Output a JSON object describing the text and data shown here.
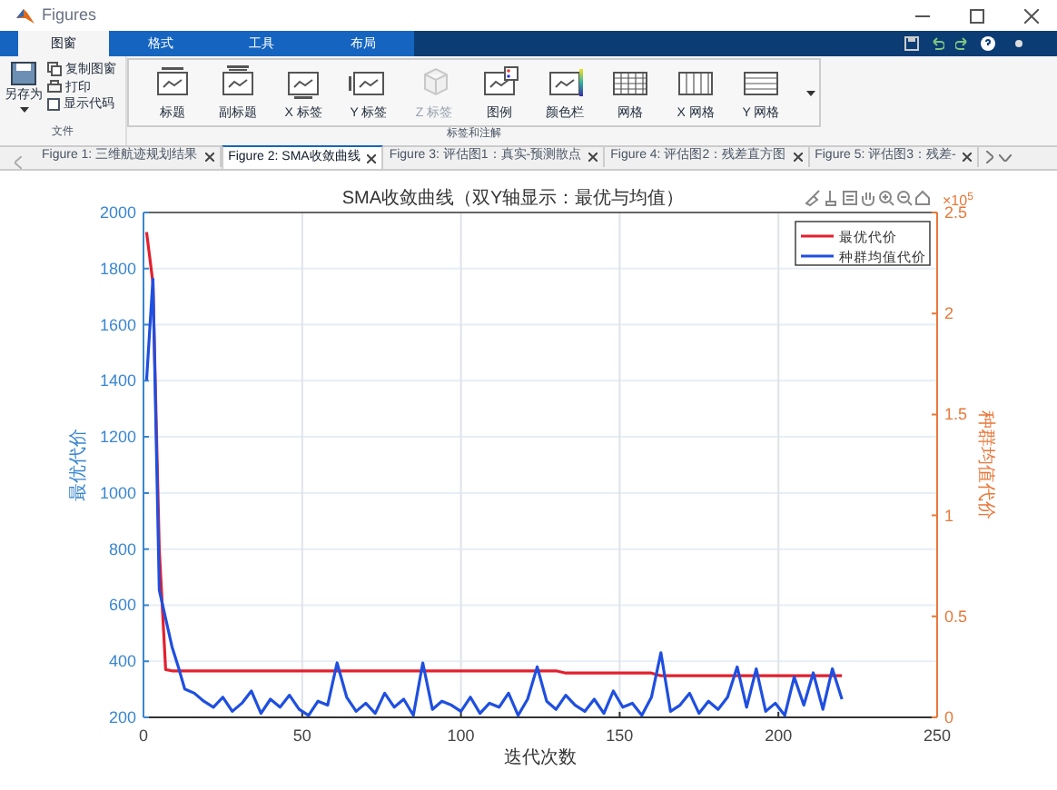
{
  "window": {
    "title": "Figures"
  },
  "ribbon_tabs": [
    {
      "label": "图窗",
      "selected": true
    },
    {
      "label": "格式",
      "selected": false
    },
    {
      "label": "工具",
      "selected": false
    },
    {
      "label": "布局",
      "selected": false
    }
  ],
  "file_group": {
    "label": "文件",
    "save_as": "另存为",
    "copy": "复制图窗",
    "print": "打印",
    "show_code": {
      "label": "显示代码",
      "checked": false
    }
  },
  "annotate_group": {
    "label": "标签和注解",
    "buttons": [
      {
        "label": "标题",
        "kind": "title",
        "disabled": false
      },
      {
        "label": "副标题",
        "kind": "subtitle",
        "disabled": false
      },
      {
        "label": "X 标签",
        "kind": "xlabel",
        "disabled": false
      },
      {
        "label": "Y 标签",
        "kind": "ylabel",
        "disabled": false
      },
      {
        "label": "Z 标签",
        "kind": "zlabel",
        "disabled": true
      },
      {
        "label": "图例",
        "kind": "legend",
        "disabled": false
      },
      {
        "label": "颜色栏",
        "kind": "colorbar",
        "disabled": false
      },
      {
        "label": "网格",
        "kind": "grid",
        "disabled": false
      },
      {
        "label": "X 网格",
        "kind": "xgrid",
        "disabled": false
      },
      {
        "label": "Y 网格",
        "kind": "ygrid",
        "disabled": false
      }
    ]
  },
  "figure_tabs": [
    {
      "label": "Figure 1: 三维航迹规划结果",
      "selected": false
    },
    {
      "label": "Figure 2: SMA收敛曲线",
      "selected": true
    },
    {
      "label": "Figure 3: 评估图1：真实-预测散点",
      "selected": false
    },
    {
      "label": "Figure 4: 评估图2：残差直方图",
      "selected": false
    },
    {
      "label": "Figure 5: 评估图3：残差-",
      "selected": false
    }
  ],
  "figure": {
    "y2_exponent": "×10$^{5}$",
    "chart_data": {
      "type": "line",
      "title": "SMA收敛曲线（双Y轴显示：最优与均值）",
      "xlabel": "迭代次数",
      "ylabel": "最优代价",
      "y2label": "种群均值代价",
      "grid": true,
      "legend": true,
      "xlim": [
        0,
        250
      ],
      "ylim": [
        200,
        2000
      ],
      "y2lim": [
        0,
        2.5
      ],
      "xticks": [
        0,
        50,
        100,
        150,
        200,
        250
      ],
      "yticks": [
        200,
        400,
        600,
        800,
        1000,
        1200,
        1400,
        1600,
        1800,
        2000
      ],
      "y2ticks": [
        0,
        0.5,
        1,
        1.5,
        2,
        2.5
      ],
      "x": [
        1,
        3,
        5,
        7,
        9,
        11,
        13,
        16,
        19,
        22,
        25,
        28,
        31,
        34,
        37,
        40,
        43,
        46,
        49,
        52,
        55,
        58,
        61,
        64,
        67,
        70,
        73,
        76,
        79,
        82,
        85,
        88,
        91,
        94,
        97,
        100,
        103,
        106,
        109,
        112,
        115,
        118,
        121,
        124,
        127,
        130,
        133,
        136,
        139,
        142,
        145,
        148,
        151,
        154,
        157,
        160,
        163,
        166,
        169,
        172,
        175,
        178,
        181,
        184,
        187,
        190,
        193,
        196,
        199,
        202,
        205,
        208,
        211,
        214,
        217,
        220
      ],
      "series": [
        {
          "name": "最优代价",
          "color": "#e3202e",
          "values": [
            1930,
            1750,
            800,
            370,
            366,
            366,
            366,
            366,
            366,
            366,
            366,
            366,
            366,
            366,
            366,
            366,
            366,
            366,
            366,
            366,
            366,
            366,
            366,
            366,
            366,
            366,
            366,
            366,
            366,
            366,
            366,
            366,
            366,
            366,
            366,
            366,
            366,
            366,
            366,
            366,
            366,
            366,
            366,
            366,
            366,
            366,
            358,
            358,
            358,
            358,
            358,
            358,
            358,
            358,
            358,
            358,
            348,
            348,
            348,
            348,
            348,
            348,
            348,
            348,
            348,
            348,
            348,
            348,
            348,
            348,
            348,
            348,
            348,
            348,
            348,
            348
          ]
        },
        {
          "name": "种群均值代价",
          "color": "#1f4fe0",
          "axis": "y2",
          "values": [
            1.67,
            2.17,
            0.63,
            0.49,
            0.35,
            0.25,
            0.14,
            0.12,
            0.08,
            0.05,
            0.1,
            0.03,
            0.07,
            0.13,
            0.02,
            0.09,
            0.05,
            0.11,
            0.04,
            0.01,
            0.08,
            0.06,
            0.27,
            0.1,
            0.03,
            0.07,
            0.02,
            0.12,
            0.05,
            0.09,
            0.01,
            0.27,
            0.04,
            0.08,
            0.06,
            0.03,
            0.1,
            0.02,
            0.07,
            0.05,
            0.12,
            0.01,
            0.09,
            0.25,
            0.08,
            0.04,
            0.11,
            0.06,
            0.03,
            0.09,
            0.02,
            0.13,
            0.05,
            0.07,
            0.01,
            0.1,
            0.32,
            0.03,
            0.06,
            0.12,
            0.02,
            0.08,
            0.04,
            0.1,
            0.25,
            0.05,
            0.24,
            0.03,
            0.07,
            0.01,
            0.2,
            0.06,
            0.22,
            0.04,
            0.24,
            0.09
          ]
        }
      ]
    }
  }
}
